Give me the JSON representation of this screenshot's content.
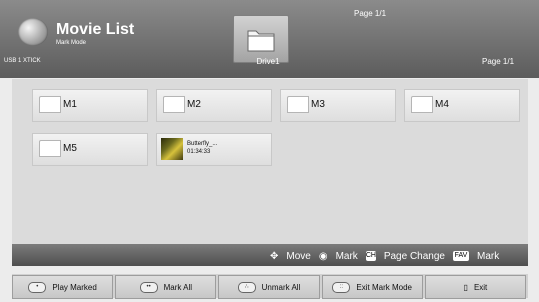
{
  "header": {
    "title": "Movie List",
    "subtitle": "Mark Mode",
    "device": "USB 1 XTICK",
    "drive_label": "Drive1",
    "page_top": "Page 1/1",
    "page_right": "Page 1/1"
  },
  "tiles": [
    {
      "label": "M1"
    },
    {
      "label": "M2"
    },
    {
      "label": "M3"
    },
    {
      "label": "M4"
    },
    {
      "label": "M5"
    }
  ],
  "movie": {
    "title": "Butterfly_...",
    "duration": "01:34:33"
  },
  "legend": {
    "move": "Move",
    "mark": "Mark",
    "ch_key": "CH",
    "page_change": "Page Change",
    "fav_key": "FAV",
    "mark_fav": "Mark"
  },
  "buttons": [
    {
      "label": "Play Marked"
    },
    {
      "label": "Mark All"
    },
    {
      "label": "Unmark All"
    },
    {
      "label": "Exit Mark Mode"
    },
    {
      "label": "Exit"
    }
  ]
}
